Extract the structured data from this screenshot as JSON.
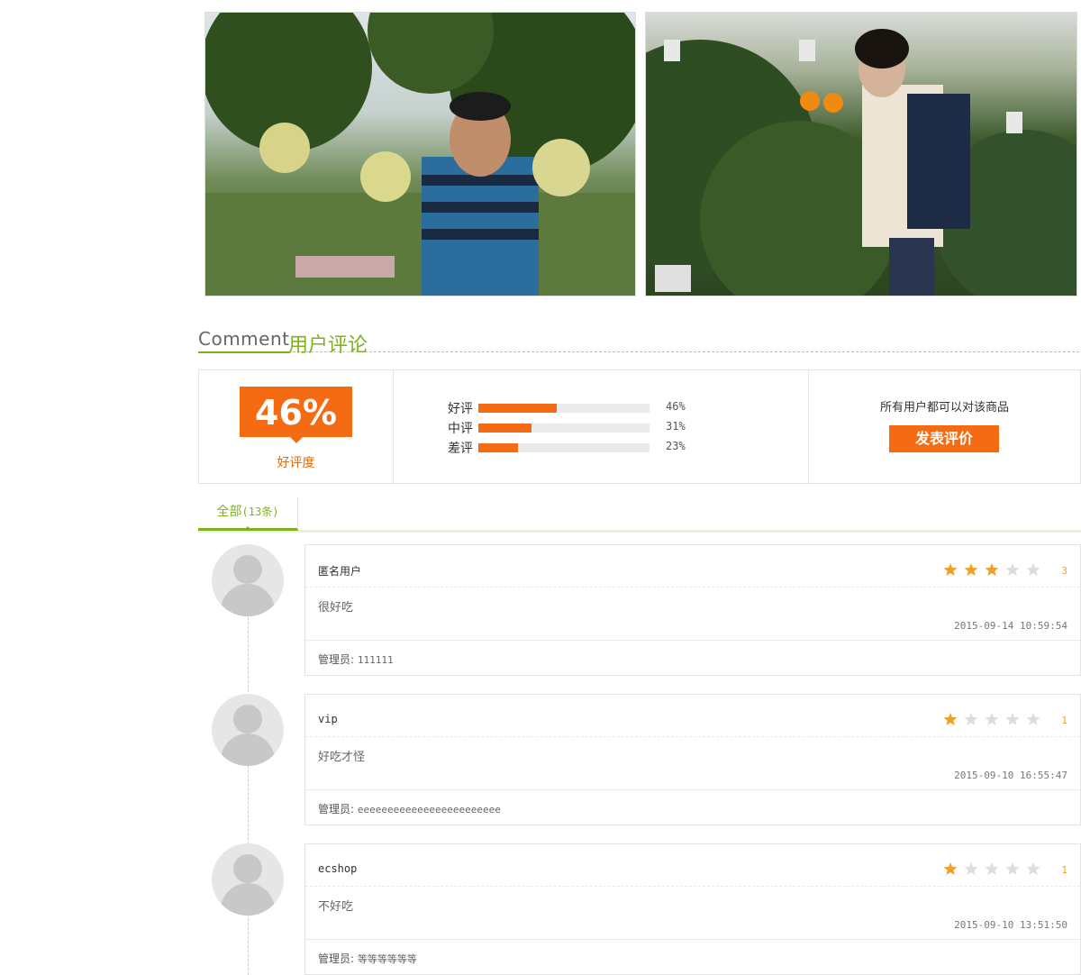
{
  "colors": {
    "accent_green": "#7fb11f",
    "accent_orange": "#f46b13",
    "star_on": "#f0a028",
    "star_off": "#dddddd"
  },
  "photos": [
    {
      "name": "man-holding-pomelos-photo"
    },
    {
      "name": "woman-holding-oranges-photo"
    }
  ],
  "section": {
    "title_en": "Comment",
    "title_cn": "用户评论"
  },
  "summary": {
    "good_percent": "46%",
    "good_label": "好评度",
    "ratings": [
      {
        "label": "好评",
        "percent": 46,
        "value": "46%"
      },
      {
        "label": "中评",
        "percent": 31,
        "value": "31%"
      },
      {
        "label": "差评",
        "percent": 23,
        "value": "23%"
      }
    ],
    "notice": "所有用户都可以对该商品",
    "post_button": "发表评价"
  },
  "tabs": {
    "all_label": "全部",
    "all_count": "(13条)"
  },
  "comments": [
    {
      "user": "匿名用户",
      "rating": 3,
      "score": "3",
      "text": "很好吃",
      "time": "2015-09-14 10:59:54",
      "reply_label": "管理员:",
      "reply": "111111"
    },
    {
      "user": "vip",
      "rating": 1,
      "score": "1",
      "text": "好吃才怪",
      "time": "2015-09-10 16:55:47",
      "reply_label": "管理员:",
      "reply": "eeeeeeeeeeeeeeeeeeeeeeee"
    },
    {
      "user": "ecshop",
      "rating": 1,
      "score": "1",
      "text": "不好吃",
      "time": "2015-09-10 13:51:50",
      "reply_label": "管理员:",
      "reply": "等等等等等等"
    }
  ]
}
